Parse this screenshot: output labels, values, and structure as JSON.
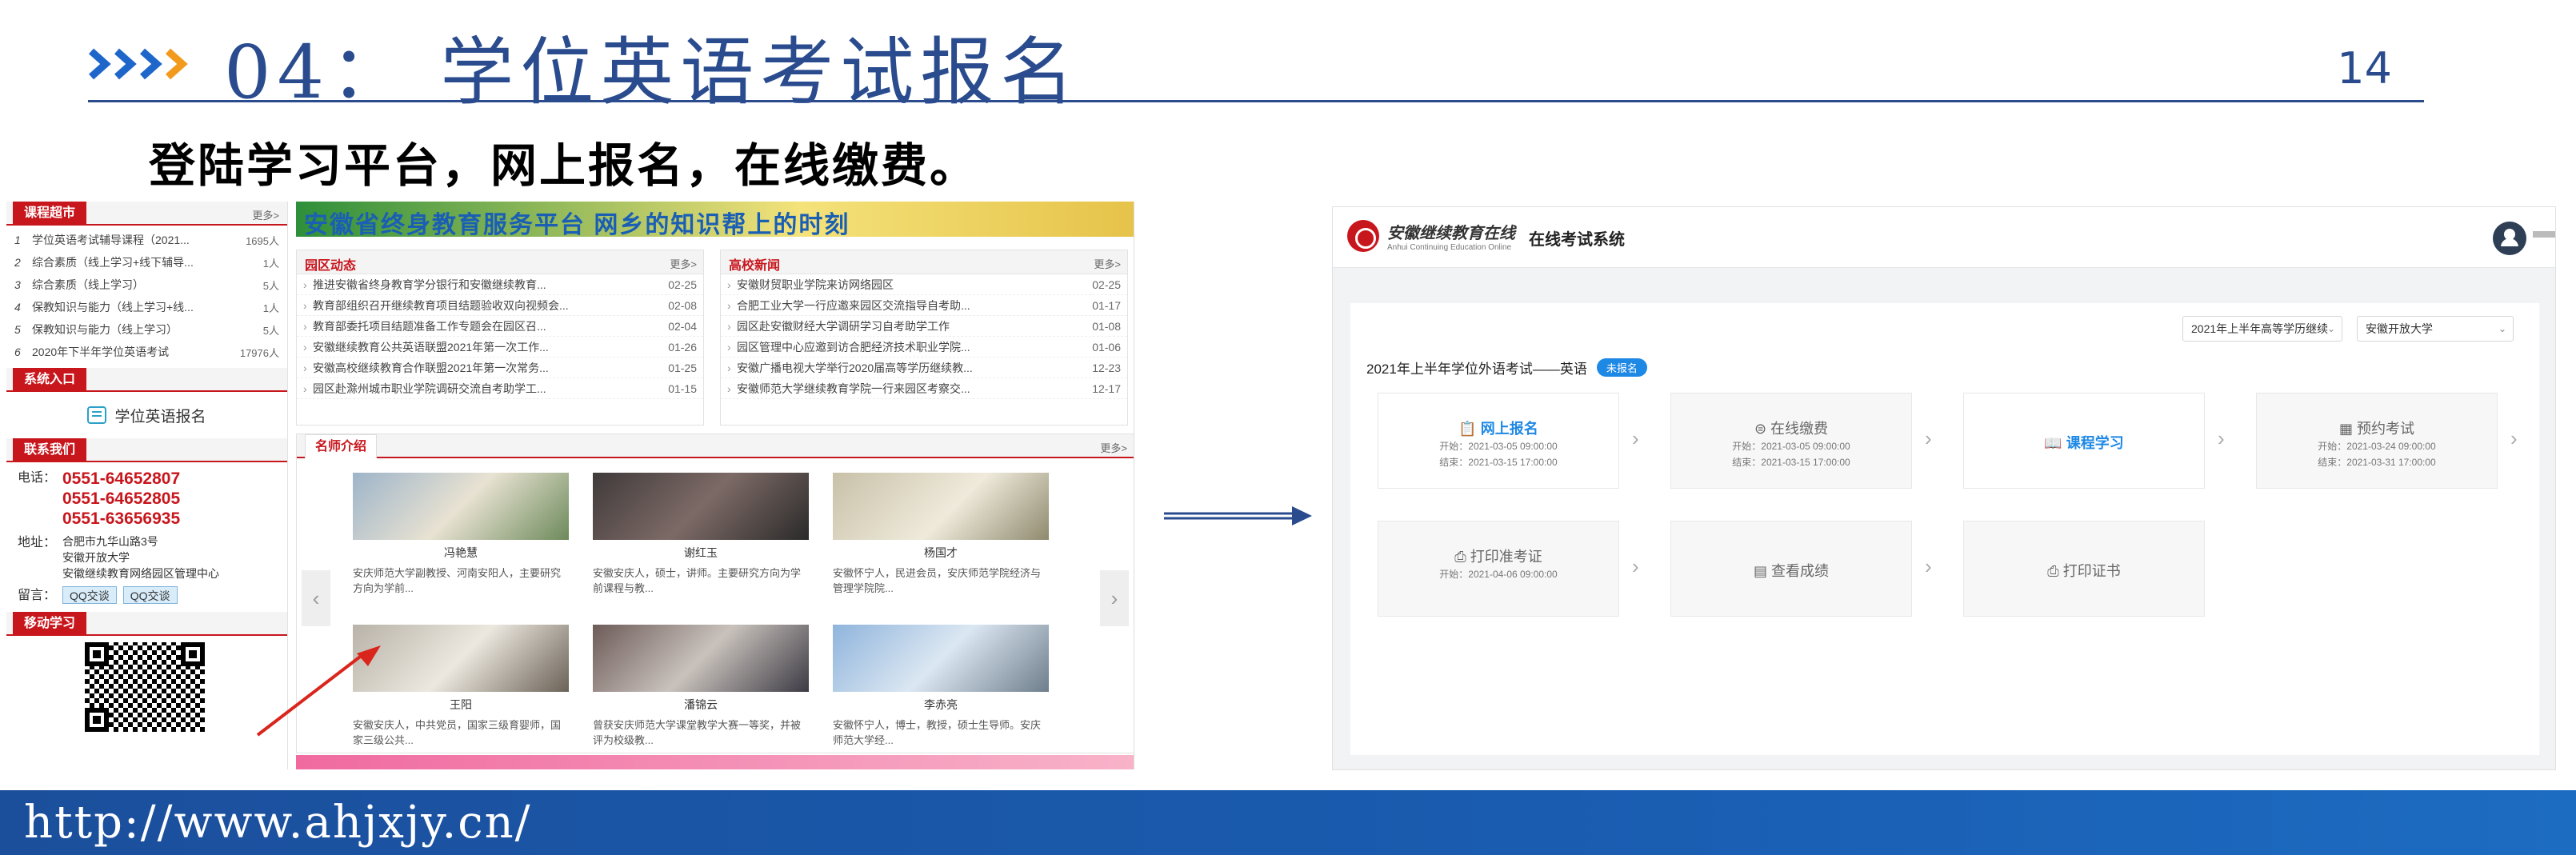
{
  "slide": {
    "title": "04：  学位英语考试报名",
    "page_number": "14",
    "subtitle": "登陆学习平台，网上报名，在线缴费。",
    "footer_url": "http://www.ahjxjy.cn/"
  },
  "portal": {
    "courses_header": "课程超市",
    "more": "更多>",
    "courses": [
      {
        "num": "1",
        "title": "学位英语考试辅导课程（2021...",
        "count": "1695人"
      },
      {
        "num": "2",
        "title": "综合素质（线上学习+线下辅导...",
        "count": "1人"
      },
      {
        "num": "3",
        "title": "综合素质（线上学习）",
        "count": "5人"
      },
      {
        "num": "4",
        "title": "保教知识与能力（线上学习+线...",
        "count": "1人"
      },
      {
        "num": "5",
        "title": "保教知识与能力（线上学习）",
        "count": "5人"
      },
      {
        "num": "6",
        "title": "2020年下半年学位英语考试",
        "count": "17976人"
      }
    ],
    "entry_header": "系统入口",
    "entry_link": "学位英语报名",
    "contact_header": "联系我们",
    "phone_label": "电话：",
    "phones": [
      "0551-64652807",
      "0551-64652805",
      "0551-63656935"
    ],
    "address_label": "地址：",
    "address_lines": [
      "合肥市九华山路3号",
      "安徽开放大学",
      "安徽继续教育网络园区管理中心"
    ],
    "message_label": "留言：",
    "qq_buttons": [
      "QQ交谈",
      "QQ交谈"
    ],
    "mobile_header": "移动学习",
    "banner_text": "安徽省终身教育服务平台 网乡的知识帮上的时刻",
    "campus_news": {
      "title": "园区动态",
      "items": [
        {
          "t": "推进安徽省终身教育学分银行和安徽继续教育...",
          "d": "02-25"
        },
        {
          "t": "教育部组织召开继续教育项目结题验收双向视频会...",
          "d": "02-08"
        },
        {
          "t": "教育部委托项目结题准备工作专题会在园区召...",
          "d": "02-04"
        },
        {
          "t": "安徽继续教育公共英语联盟2021年第一次工作...",
          "d": "01-26"
        },
        {
          "t": "安徽高校继续教育合作联盟2021年第一次常务...",
          "d": "01-25"
        },
        {
          "t": "园区赴滁州城市职业学院调研交流自考助学工...",
          "d": "01-15"
        }
      ]
    },
    "school_news": {
      "title": "高校新闻",
      "items": [
        {
          "t": "安徽财贸职业学院来访网络园区",
          "d": "02-25"
        },
        {
          "t": "合肥工业大学一行应邀来园区交流指导自考助...",
          "d": "01-17"
        },
        {
          "t": "园区赴安徽财经大学调研学习自考助学工作",
          "d": "01-08"
        },
        {
          "t": "园区管理中心应邀到访合肥经济技术职业学院...",
          "d": "01-06"
        },
        {
          "t": "安徽广播电视大学举行2020届高等学历继续教...",
          "d": "12-23"
        },
        {
          "t": "安徽师范大学继续教育学院一行来园区考察交...",
          "d": "12-17"
        }
      ]
    },
    "teachers_header": "名师介绍",
    "teachers": [
      {
        "name": "冯艳慧",
        "desc": "安庆师范大学副教授、河南安阳人，主要研究方向为学前..."
      },
      {
        "name": "谢红玉",
        "desc": "安徽安庆人，硕士，讲师。主要研究方向为学前课程与教..."
      },
      {
        "name": "杨国才",
        "desc": "安徽怀宁人，民进会员，安庆师范学院经济与管理学院院..."
      },
      {
        "name": "王阳",
        "desc": "安徽安庆人，中共党员，国家三级育婴师，国家三级公共..."
      },
      {
        "name": "潘锦云",
        "desc": "曾获安庆师范大学课堂教学大赛一等奖，并被评为校级教..."
      },
      {
        "name": "李赤亮",
        "desc": "安徽怀宁人，博士，教授，硕士生导师。安庆师范大学经..."
      }
    ]
  },
  "exam": {
    "logo_cn": "安徽继续教育在线",
    "logo_en": "Anhui Continuing Education Online",
    "system_title": "在线考试系统",
    "select_term": "2021年上半年高等学历继续",
    "select_school": "安徽开放大学",
    "exam_title": "2021年上半年学位外语考试——英语",
    "status_badge": "未报名",
    "steps": [
      {
        "title": "网上报名",
        "start": "开始：2021-03-05 09:00:00",
        "end": "结束：2021-03-15 17:00:00"
      },
      {
        "title": "在线缴费",
        "start": "开始：2021-03-05 09:00:00",
        "end": "结束：2021-03-15 17:00:00"
      },
      {
        "title": "课程学习",
        "start": "",
        "end": ""
      },
      {
        "title": "预约考试",
        "start": "开始：2021-03-24 09:00:00",
        "end": "结束：2021-03-31 17:00:00"
      },
      {
        "title": "打印准考证",
        "start": "开始：2021-04-06 09:00:00",
        "end": ""
      },
      {
        "title": "查看成绩",
        "start": "",
        "end": ""
      },
      {
        "title": "打印证书",
        "start": "",
        "end": ""
      }
    ]
  },
  "colors": {
    "brand_blue": "#2a4c8e",
    "portal_red": "#c8161d",
    "exam_blue": "#1e88e5",
    "chevron_blue": "#1e66c9",
    "chevron_orange": "#f29a1c"
  }
}
